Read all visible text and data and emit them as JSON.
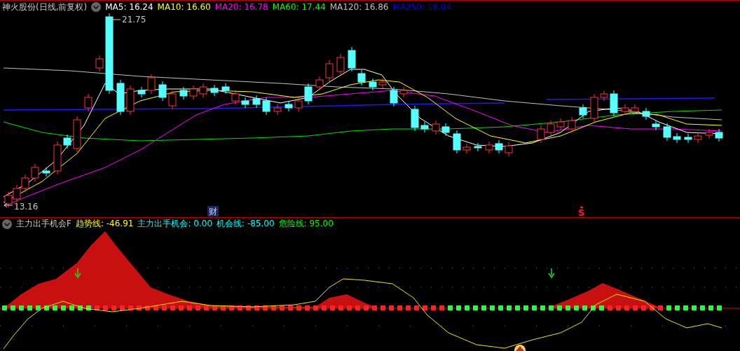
{
  "title": "神火股份(日线,前复权)",
  "moving_averages": [
    {
      "label": "MA5: 16.24",
      "color": "#ffffff"
    },
    {
      "label": "MA10: 16.60",
      "color": "#ffff00"
    },
    {
      "label": "MA20: 16.78",
      "color": "#ff00ff"
    },
    {
      "label": "MA60: 17.44",
      "color": "#00ff00"
    },
    {
      "label": "MA120: 16.86",
      "color": "#c0c0c0"
    },
    {
      "label": "MA250: 18.04",
      "color": "#0000ff"
    }
  ],
  "price_chart": {
    "high_label": "21.75",
    "low_label": "13.16",
    "markers": [
      {
        "kind": "news",
        "text": "财"
      },
      {
        "kind": "signal",
        "text": "S"
      }
    ]
  },
  "indicator": {
    "name": "主力出手机会F",
    "lines": [
      {
        "label": "趋势线: -46.91",
        "color": "#ffff00"
      },
      {
        "label": "主力出手机会: 0.00",
        "color": "#00ffff"
      },
      {
        "label": "机会线: -85.00",
        "color": "#00ffff"
      },
      {
        "label": "危险线: 95.00",
        "color": "#00ff00"
      }
    ]
  }
}
